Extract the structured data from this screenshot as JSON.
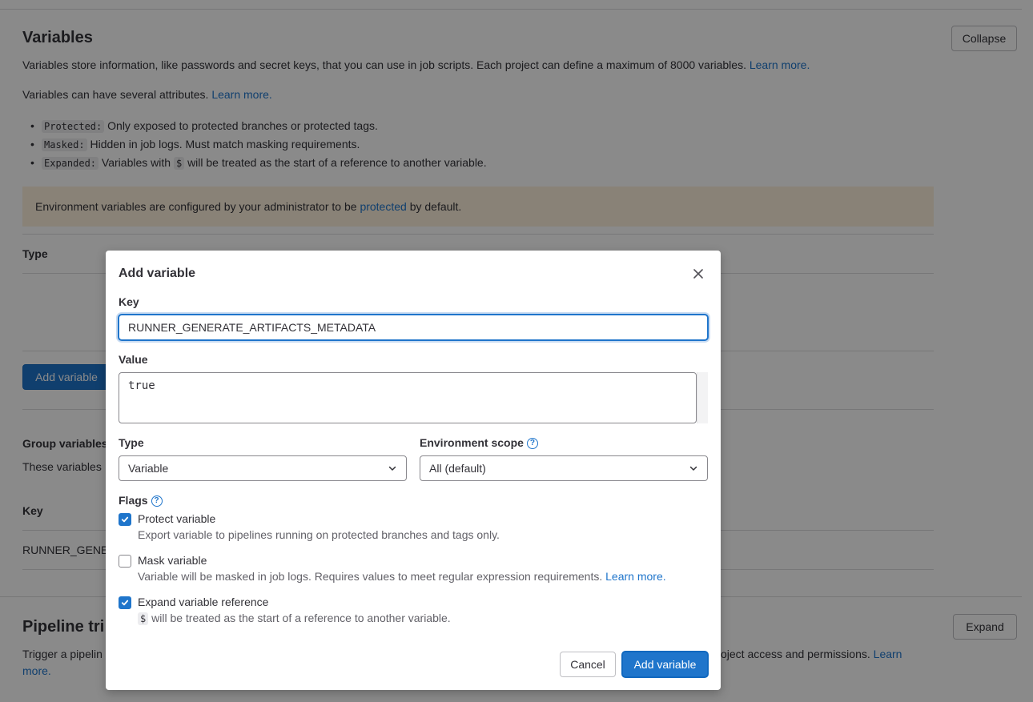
{
  "background": {
    "section_title": "Variables",
    "collapse_label": "Collapse",
    "desc_text": "Variables store information, like passwords and secret keys, that you can use in job scripts. Each project can define a maximum of 8000 variables.",
    "desc_link": "Learn more.",
    "attrs_text": "Variables can have several attributes.",
    "attrs_link": "Learn more.",
    "bullets": [
      {
        "code": "Protected:",
        "text": "Only exposed to protected branches or protected tags."
      },
      {
        "code": "Masked:",
        "text": "Hidden in job logs. Must match masking requirements."
      },
      {
        "code": "Expanded:",
        "pre": "Variables with",
        "code2": "$",
        "post": "will be treated as the start of a reference to another variable."
      }
    ],
    "alert_pre": "Environment variables are configured by your administrator to be",
    "alert_link": "protected",
    "alert_post": "by default.",
    "table_header_type": "Type",
    "add_variable_label": "Add variable",
    "group_variables_title": "Group variables",
    "group_variables_desc": "These variables",
    "group_key_header": "Key",
    "group_row_key": "RUNNER_GENE",
    "pipeline_title": "Pipeline tri",
    "expand_label": "Expand",
    "pipeline_desc_start": "Trigger a pipelin",
    "pipeline_desc_end": "oject access and permissions.",
    "pipeline_link_1": "Learn",
    "pipeline_link_2": "more."
  },
  "modal": {
    "title": "Add variable",
    "key_label": "Key",
    "key_value": "RUNNER_GENERATE_ARTIFACTS_METADATA",
    "value_label": "Value",
    "value_text": "true",
    "type_label": "Type",
    "type_value": "Variable",
    "env_scope_label": "Environment scope",
    "env_scope_value": "All (default)",
    "flags_label": "Flags",
    "flags": {
      "protect": {
        "label": "Protect variable",
        "help": "Export variable to pipelines running on protected branches and tags only.",
        "checked": true
      },
      "mask": {
        "label": "Mask variable",
        "help": "Variable will be masked in job logs. Requires values to meet regular expression requirements.",
        "link": "Learn more.",
        "checked": false
      },
      "expand": {
        "label": "Expand variable reference",
        "code": "$",
        "help": "will be treated as the start of a reference to another variable.",
        "checked": true
      }
    },
    "cancel_label": "Cancel",
    "submit_label": "Add variable"
  },
  "colors": {
    "primary": "#1f75cb",
    "overlay": "rgba(0,0,0,0.46)"
  }
}
